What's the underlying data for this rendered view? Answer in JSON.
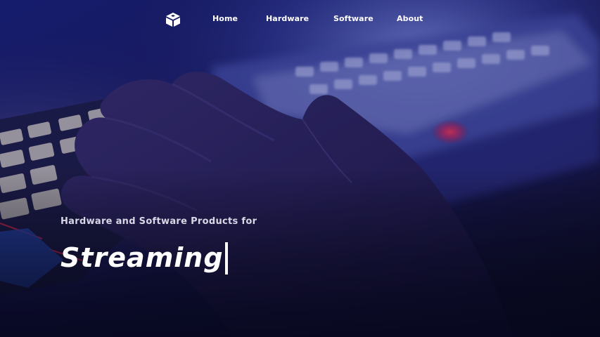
{
  "nav": {
    "logo_icon": "box-logo-icon",
    "items": [
      {
        "label": "Home"
      },
      {
        "label": "Hardware"
      },
      {
        "label": "Software"
      },
      {
        "label": "About"
      }
    ]
  },
  "hero": {
    "subtitle": "Hardware and Software Products for",
    "typed_word": "Streaming",
    "background": "photo-hand-on-backlit-keyboard"
  },
  "colors": {
    "overlay": "#1a1850",
    "text": "#ffffff",
    "accent_red": "#ff2b4a"
  }
}
